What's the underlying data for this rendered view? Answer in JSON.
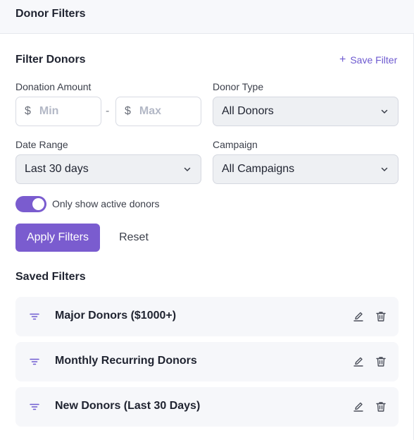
{
  "header": {
    "title": "Donor Filters"
  },
  "filter": {
    "title": "Filter Donors",
    "save_label": "Save Filter",
    "amount": {
      "label": "Donation Amount",
      "currency": "$",
      "min_placeholder": "Min",
      "max_placeholder": "Max",
      "separator": "-"
    },
    "donor_type": {
      "label": "Donor Type",
      "value": "All Donors"
    },
    "date_range": {
      "label": "Date Range",
      "value": "Last 30 days"
    },
    "campaign": {
      "label": "Campaign",
      "value": "All Campaigns"
    },
    "active_toggle": {
      "label": "Only show active donors",
      "on": true
    },
    "apply_label": "Apply Filters",
    "reset_label": "Reset"
  },
  "saved": {
    "title": "Saved Filters",
    "items": [
      {
        "name": "Major Donors ($1000+)"
      },
      {
        "name": "Monthly Recurring Donors"
      },
      {
        "name": "New Donors (Last 30 Days)"
      }
    ]
  },
  "colors": {
    "accent": "#7a5ccf",
    "link": "#6e5ad0"
  }
}
